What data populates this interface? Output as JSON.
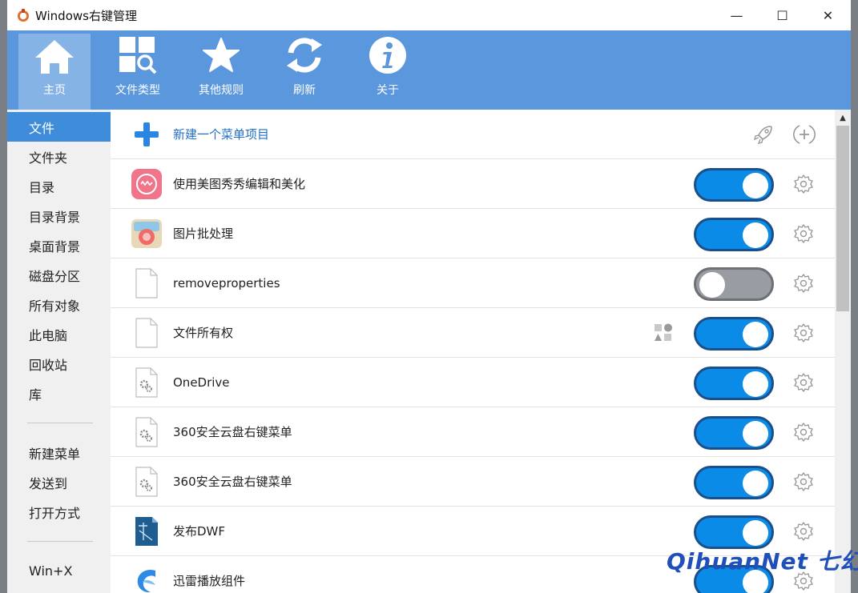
{
  "window": {
    "title": "Windows右键管理",
    "minimize": "—",
    "maximize": "☐",
    "close": "✕"
  },
  "toolbar": [
    {
      "label": "主页",
      "icon": "home-icon"
    },
    {
      "label": "文件类型",
      "icon": "file-types-icon"
    },
    {
      "label": "其他规则",
      "icon": "star-icon"
    },
    {
      "label": "刷新",
      "icon": "refresh-icon"
    },
    {
      "label": "关于",
      "icon": "info-icon"
    }
  ],
  "sidebar": {
    "groups": [
      [
        "文件",
        "文件夹",
        "目录",
        "目录背景",
        "桌面背景",
        "磁盘分区",
        "所有对象",
        "此电脑",
        "回收站",
        "库"
      ],
      [
        "新建菜单",
        "发送到",
        "打开方式"
      ],
      [
        "Win+X"
      ]
    ],
    "active": "文件"
  },
  "items": [
    {
      "label": "新建一个菜单项目",
      "type": "new"
    },
    {
      "label": "使用美图秀秀编辑和美化",
      "enabled": true,
      "icon": "meitu-icon"
    },
    {
      "label": "图片批处理",
      "enabled": true,
      "icon": "image-batch-icon"
    },
    {
      "label": "removeproperties",
      "enabled": false,
      "icon": "blank-file-icon"
    },
    {
      "label": "文件所有权",
      "enabled": true,
      "icon": "blank-file-icon",
      "extra": "shapes-icon"
    },
    {
      "label": "OneDrive",
      "enabled": true,
      "icon": "settings-file-icon"
    },
    {
      "label": "360安全云盘右键菜单",
      "enabled": true,
      "icon": "settings-file-icon"
    },
    {
      "label": "360安全云盘右键菜单",
      "enabled": true,
      "icon": "settings-file-icon"
    },
    {
      "label": "发布DWF",
      "enabled": true,
      "icon": "dwf-icon"
    },
    {
      "label": "迅雷播放组件",
      "enabled": true,
      "icon": "xunlei-icon"
    }
  ],
  "watermark": "QihuanNet 七幻",
  "colors": {
    "toolbar": "#5b97dd",
    "accent": "#3f8cdb",
    "toggle_on": "#0b8be8",
    "toggle_off": "#999da3"
  }
}
